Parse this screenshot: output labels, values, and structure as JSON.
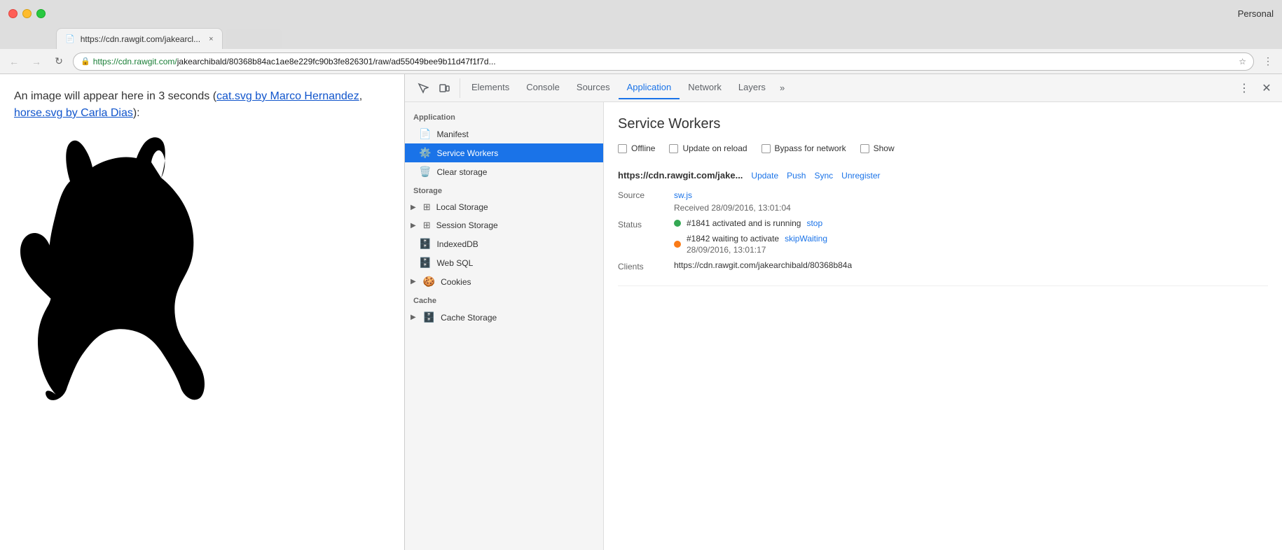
{
  "browser": {
    "profile": "Personal",
    "tab": {
      "url_display": "https://cdn.rawgit.com/jakearcl...",
      "url_full": "https://cdn.rawgit.com/jakearchibald/80368b84ac1ae8e229fc90b3fe826301/raw/ad55049bee9b11d47f1f7d...",
      "url_https": "https://cdn.rawgit.com/",
      "url_rest": "jakearchibald/80368b84ac1ae8e229fc90b3fe826301/raw/ad55049bee9b11d47f1f7d...",
      "favicon": "📄",
      "close": "×"
    }
  },
  "page": {
    "text_before": "An image will appear here in 3 seconds (",
    "link1": "cat.svg by Marco Hernandez",
    "link1_href": "#",
    "separator": ", ",
    "link2": "horse.svg by Carla Dias",
    "link2_href": "#",
    "text_after": "):"
  },
  "devtools": {
    "tabs": [
      {
        "id": "elements",
        "label": "Elements",
        "active": false
      },
      {
        "id": "console",
        "label": "Console",
        "active": false
      },
      {
        "id": "sources",
        "label": "Sources",
        "active": false
      },
      {
        "id": "application",
        "label": "Application",
        "active": true
      },
      {
        "id": "network",
        "label": "Network",
        "active": false
      },
      {
        "id": "layers",
        "label": "Layers",
        "active": false
      }
    ],
    "more_tabs": "»",
    "sidebar": {
      "application_label": "Application",
      "items_application": [
        {
          "id": "manifest",
          "label": "Manifest",
          "icon": "📄",
          "active": false,
          "arrow": false
        },
        {
          "id": "service-workers",
          "label": "Service Workers",
          "icon": "⚙️",
          "active": true,
          "arrow": false
        },
        {
          "id": "clear-storage",
          "label": "Clear storage",
          "icon": "🗑️",
          "active": false,
          "arrow": false
        }
      ],
      "storage_label": "Storage",
      "items_storage": [
        {
          "id": "local-storage",
          "label": "Local Storage",
          "icon": "▦",
          "active": false,
          "arrow": true
        },
        {
          "id": "session-storage",
          "label": "Session Storage",
          "icon": "▦",
          "active": false,
          "arrow": true
        },
        {
          "id": "indexeddb",
          "label": "IndexedDB",
          "icon": "🗄️",
          "active": false,
          "arrow": false
        },
        {
          "id": "web-sql",
          "label": "Web SQL",
          "icon": "🗄️",
          "active": false,
          "arrow": false
        },
        {
          "id": "cookies",
          "label": "Cookies",
          "icon": "🍪",
          "active": false,
          "arrow": true
        }
      ],
      "cache_label": "Cache",
      "items_cache": [
        {
          "id": "cache-storage",
          "label": "Cache Storage",
          "icon": "🗄️",
          "active": false,
          "arrow": true
        }
      ]
    },
    "panel": {
      "title": "Service Workers",
      "options": [
        {
          "id": "offline",
          "label": "Offline",
          "checked": false
        },
        {
          "id": "update-on-reload",
          "label": "Update on reload",
          "checked": false
        },
        {
          "id": "bypass-for-network",
          "label": "Bypass for network",
          "checked": false
        },
        {
          "id": "show",
          "label": "Show",
          "checked": false
        }
      ],
      "sw_entry": {
        "url": "https://cdn.rawgit.com/jake...",
        "actions": [
          {
            "id": "update",
            "label": "Update"
          },
          {
            "id": "push",
            "label": "Push"
          },
          {
            "id": "sync",
            "label": "Sync"
          },
          {
            "id": "unregister",
            "label": "Unregister"
          }
        ],
        "source_label": "Source",
        "source_file": "sw.js",
        "received_label": "Received",
        "received_value": "28/09/2016, 13:01:04",
        "status_label": "Status",
        "status_entries": [
          {
            "id": "running",
            "dot": "green",
            "text": "#1841 activated and is running",
            "action_label": "stop",
            "action_id": "stop"
          },
          {
            "id": "waiting",
            "dot": "orange",
            "text": "#1842 waiting to activate",
            "action_label": "skipWaiting",
            "action_id": "skip-waiting",
            "time": "28/09/2016, 13:01:17"
          }
        ],
        "clients_label": "Clients",
        "clients_value": "https://cdn.rawgit.com/jakearchibald/80368b84a"
      }
    }
  }
}
